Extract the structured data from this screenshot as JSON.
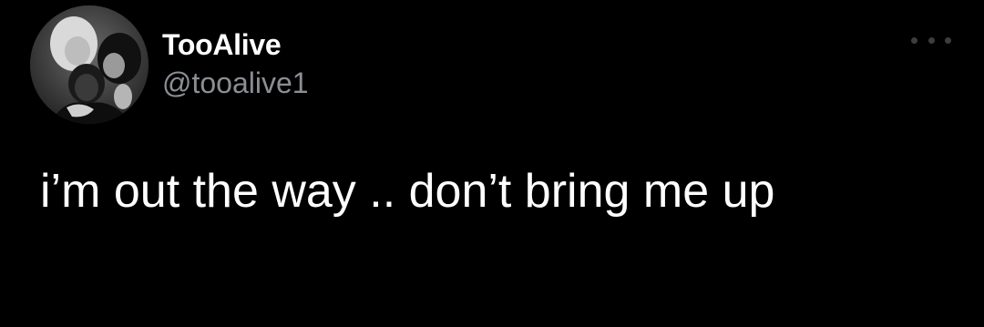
{
  "tweet": {
    "author": {
      "display_name": "TooAlive",
      "handle": "@tooalive1",
      "avatar_icon": "profile-photo"
    },
    "text": "i’m out the way .. don’t bring me up",
    "more_icon": "ellipsis-icon"
  },
  "colors": {
    "background": "#000000",
    "primary_text": "#ffffff",
    "secondary_text": "#8b8f94",
    "icon": "#3b3d40"
  }
}
